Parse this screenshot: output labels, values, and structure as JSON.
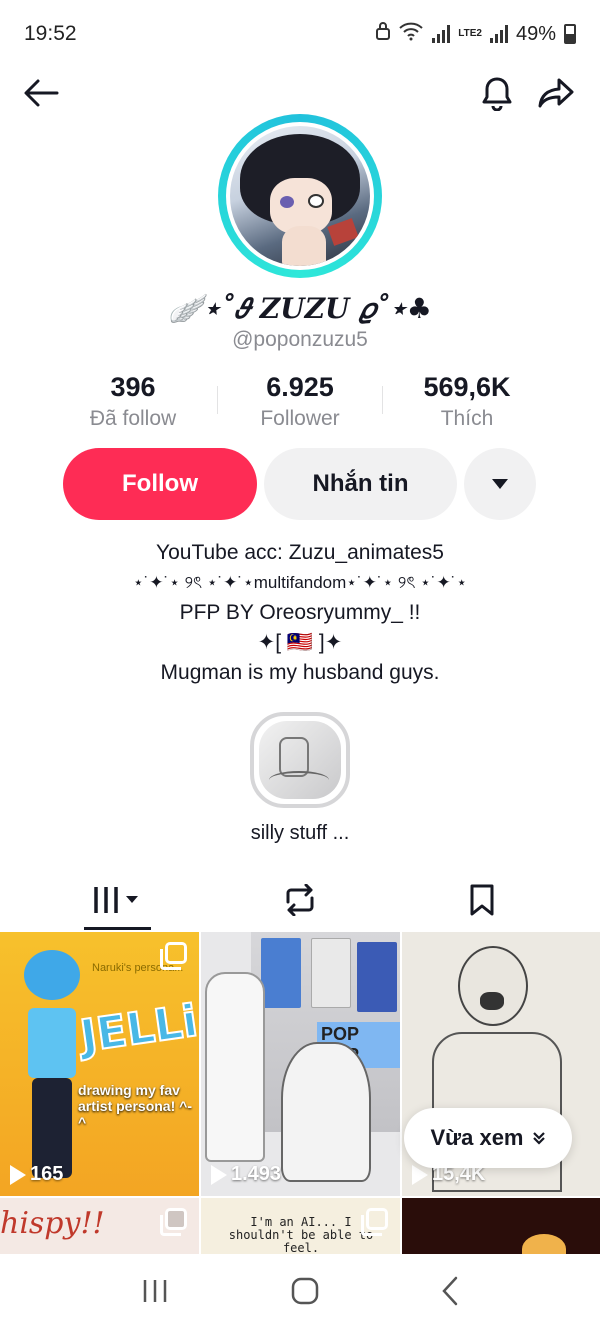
{
  "status_bar": {
    "time": "19:52",
    "network": "LTE2",
    "battery": "49%"
  },
  "profile": {
    "display_name": "🪽⋆˚𝜗 ZUZU 𝜚˚⋆♣",
    "username": "@poponzuzu5",
    "stats": [
      {
        "value": "396",
        "label": "Đã follow"
      },
      {
        "value": "6.925",
        "label": "Follower"
      },
      {
        "value": "569,6K",
        "label": "Thích"
      }
    ],
    "follow_label": "Follow",
    "message_label": "Nhắn tin",
    "bio": [
      "YouTube acc: Zuzu_animates5",
      "⋆˙✦˙⋆ ୨ৎ ⋆˙✦˙⋆multifandom⋆˙✦˙⋆ ୨ৎ ⋆˙✦˙⋆",
      "PFP BY Oreosryummy_ !!",
      "✦[ 🇲🇾 ]✦",
      "Mugman is my husband guys."
    ],
    "highlight_label": "silly stuff ..."
  },
  "videos": [
    {
      "views": "165",
      "title": "JELLi!",
      "caption": "drawing my fav artist persona! ^-^",
      "tag": "Naruki's persona...",
      "multi": true
    },
    {
      "views": "1.493",
      "label": "POP POP",
      "multi": false
    },
    {
      "views": "15,4K",
      "multi": false
    },
    {
      "text": "hispy!!",
      "multi": true
    },
    {
      "text": "I'm an AI... I shouldn't be able to feel.",
      "multi": true
    },
    {
      "multi": false
    }
  ],
  "recently_viewed_label": "Vừa xem",
  "colors": {
    "primary": "#fe2c55",
    "ring": "#21c1dc",
    "secondary_bg": "#f1f1f2"
  }
}
